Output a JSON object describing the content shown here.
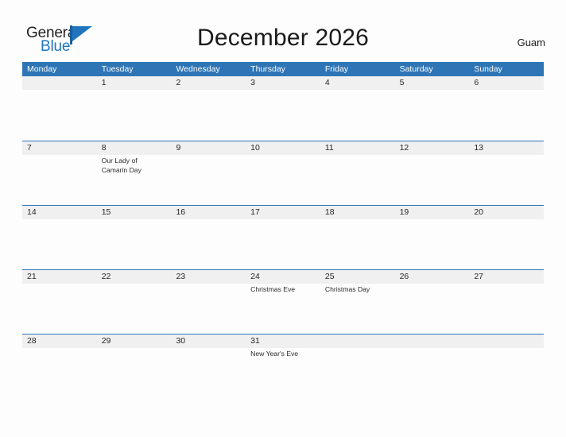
{
  "brand": {
    "name_part1": "General",
    "name_part2": "Blue",
    "mark": "flag-triangle-icon"
  },
  "header": {
    "title": "December 2026",
    "location": "Guam"
  },
  "calendar": {
    "weekday_headers": [
      "Monday",
      "Tuesday",
      "Wednesday",
      "Thursday",
      "Friday",
      "Saturday",
      "Sunday"
    ],
    "accent_color": "#2e75b6",
    "date_band_color": "#f0f0f0",
    "weeks": [
      {
        "days": [
          {
            "date": "",
            "events": []
          },
          {
            "date": "1",
            "events": []
          },
          {
            "date": "2",
            "events": []
          },
          {
            "date": "3",
            "events": []
          },
          {
            "date": "4",
            "events": []
          },
          {
            "date": "5",
            "events": []
          },
          {
            "date": "6",
            "events": []
          }
        ]
      },
      {
        "days": [
          {
            "date": "7",
            "events": []
          },
          {
            "date": "8",
            "events": [
              "Our Lady of Camarin Day"
            ]
          },
          {
            "date": "9",
            "events": []
          },
          {
            "date": "10",
            "events": []
          },
          {
            "date": "11",
            "events": []
          },
          {
            "date": "12",
            "events": []
          },
          {
            "date": "13",
            "events": []
          }
        ]
      },
      {
        "days": [
          {
            "date": "14",
            "events": []
          },
          {
            "date": "15",
            "events": []
          },
          {
            "date": "16",
            "events": []
          },
          {
            "date": "17",
            "events": []
          },
          {
            "date": "18",
            "events": []
          },
          {
            "date": "19",
            "events": []
          },
          {
            "date": "20",
            "events": []
          }
        ]
      },
      {
        "days": [
          {
            "date": "21",
            "events": []
          },
          {
            "date": "22",
            "events": []
          },
          {
            "date": "23",
            "events": []
          },
          {
            "date": "24",
            "events": [
              "Christmas Eve"
            ]
          },
          {
            "date": "25",
            "events": [
              "Christmas Day"
            ]
          },
          {
            "date": "26",
            "events": []
          },
          {
            "date": "27",
            "events": []
          }
        ]
      },
      {
        "days": [
          {
            "date": "28",
            "events": []
          },
          {
            "date": "29",
            "events": []
          },
          {
            "date": "30",
            "events": []
          },
          {
            "date": "31",
            "events": [
              "New Year's Eve"
            ]
          },
          {
            "date": "",
            "events": []
          },
          {
            "date": "",
            "events": []
          },
          {
            "date": "",
            "events": []
          }
        ]
      }
    ]
  }
}
